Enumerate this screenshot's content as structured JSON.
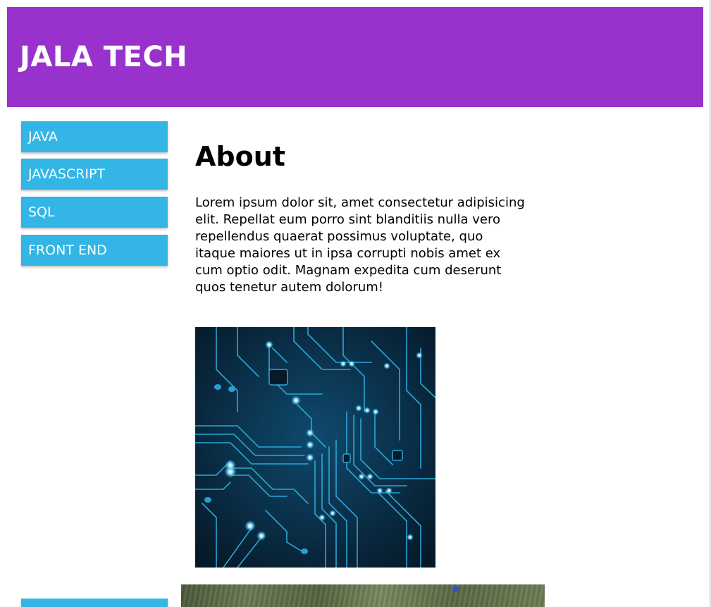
{
  "header": {
    "title": "JALA TECH",
    "background_color": "#9932cc"
  },
  "sidebar": {
    "accent_color": "#33b5e5",
    "items": [
      {
        "label": "JAVA"
      },
      {
        "label": "JAVASCRIPT"
      },
      {
        "label": "SQL"
      },
      {
        "label": "FRONT END"
      }
    ]
  },
  "main": {
    "heading": "About",
    "paragraph": "Lorem ipsum dolor sit, amet consectetur adipisicing elit. Repellat eum porro sint blanditiis nulla vero repellendus quaerat possimus voluptate, quo itaque maiores ut in ipsa corrupti nobis amet ex cum optio odit. Magnam expedita cum deserunt quos tenetur autem dolorum!",
    "images": [
      {
        "name": "circuit-board-image"
      },
      {
        "name": "grass-image"
      }
    ]
  }
}
